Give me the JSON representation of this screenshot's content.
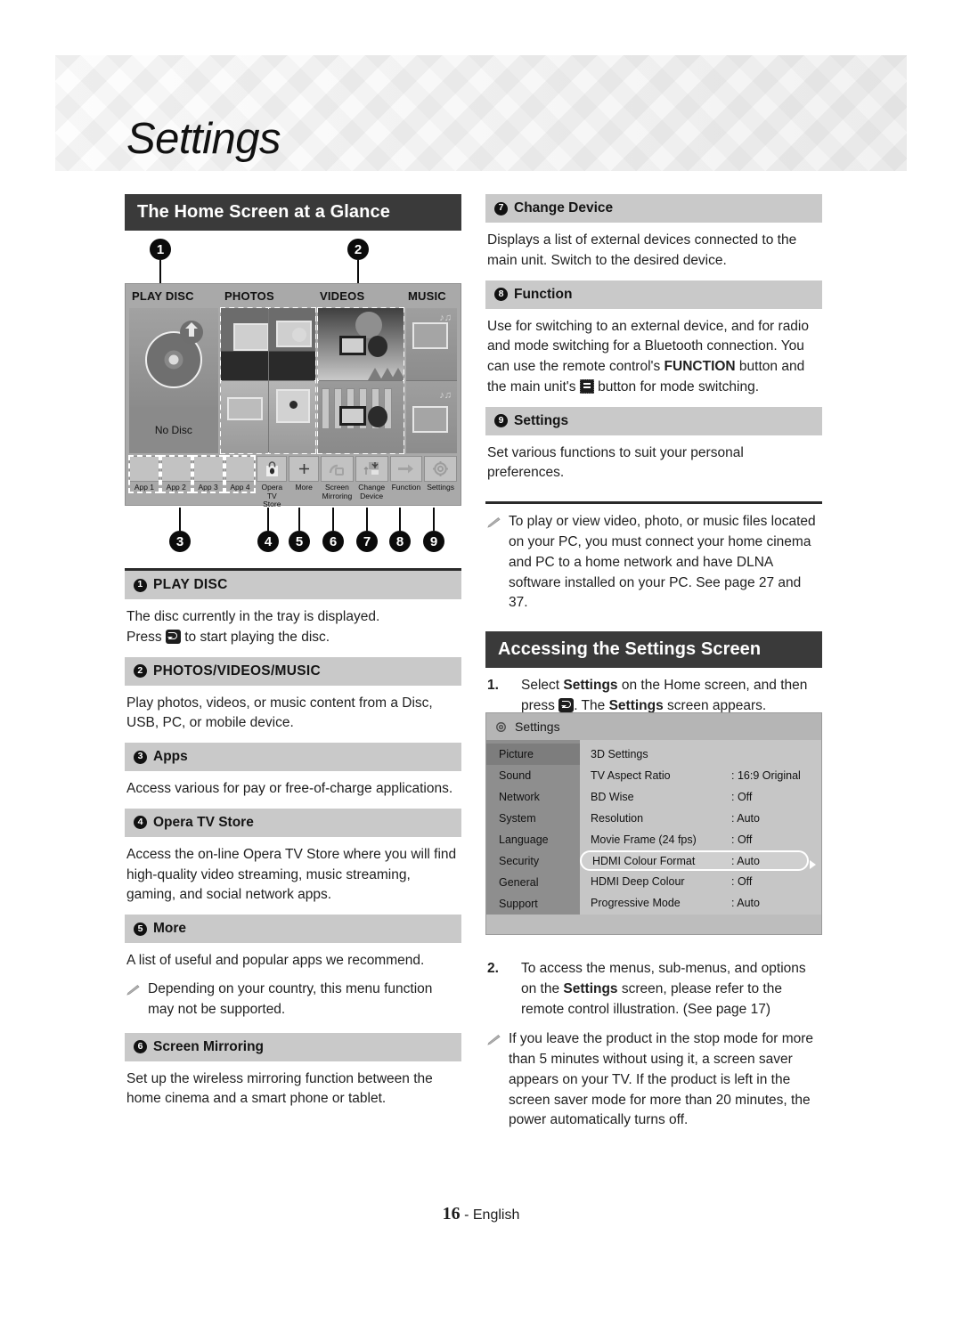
{
  "header": {
    "title": "Settings"
  },
  "left": {
    "section_title": "The Home Screen at a Glance",
    "callouts_top": [
      "1",
      "2"
    ],
    "callouts_bottom": [
      "3",
      "4",
      "5",
      "6",
      "7",
      "8",
      "9"
    ],
    "home_screen": {
      "categories": [
        "PLAY DISC",
        "PHOTOS",
        "VIDEOS",
        "MUSIC"
      ],
      "disc_status": "No Disc",
      "apps": [
        "App 1",
        "App 2",
        "App 3",
        "App 4"
      ],
      "bar_items": [
        {
          "label_line1": "Opera TV",
          "label_line2": "Store",
          "icon": "shopping-bag-icon"
        },
        {
          "label_line1": "More",
          "label_line2": "",
          "icon": "plus-icon"
        },
        {
          "label_line1": "Screen",
          "label_line2": "Mirroring",
          "icon": "screen-mirroring-icon"
        },
        {
          "label_line1": "Change",
          "label_line2": "Device",
          "icon": "change-device-icon"
        },
        {
          "label_line1": "Function",
          "label_line2": "",
          "icon": "arrow-right-icon"
        },
        {
          "label_line1": "Settings",
          "label_line2": "",
          "icon": "gear-icon"
        }
      ]
    },
    "entries": [
      {
        "num": "1",
        "title": "PLAY DISC",
        "caps": true,
        "body_a": "The disc currently in the tray is displayed.",
        "body_b_pre": "Press ",
        "body_b_post": " to start playing the disc."
      },
      {
        "num": "2",
        "title": "PHOTOS/VIDEOS/MUSIC",
        "caps": true,
        "body": "Play photos, videos, or music content from a Disc, USB, PC, or mobile device."
      },
      {
        "num": "3",
        "title": "Apps",
        "caps": false,
        "body": "Access various for pay or free-of-charge applications."
      },
      {
        "num": "4",
        "title": "Opera TV Store",
        "caps": false,
        "body": "Access the on-line Opera TV Store where you will find high-quality video streaming, music streaming, gaming, and social network apps."
      },
      {
        "num": "5",
        "title": "More",
        "caps": false,
        "body": "A list of useful and popular apps we recommend.",
        "note": "Depending on your country, this menu function may not be supported."
      },
      {
        "num": "6",
        "title": "Screen Mirroring",
        "caps": false,
        "body": "Set up the wireless mirroring function between the home cinema and a smart phone or tablet."
      }
    ]
  },
  "right": {
    "entries": [
      {
        "num": "7",
        "title": "Change Device",
        "body": "Displays a list of external devices connected to the main unit. Switch to the desired device."
      },
      {
        "num": "8",
        "title": "Function",
        "body_p1": "Use for switching to an external device, and for radio and mode switching for a Bluetooth connection. You can use the remote control's ",
        "body_bold": "FUNCTION",
        "body_p2": " button and the main unit's ",
        "body_p3": " button for mode switching."
      },
      {
        "num": "9",
        "title": "Settings",
        "body": "Set various functions to suit your personal preferences."
      }
    ],
    "note_dlna": "To play or view video, photo, or music files located on your PC, you must connect your home cinema and PC to a home network and have DLNA software installed on your PC. See page 27 and 37.",
    "section_title": "Accessing the Settings Screen",
    "step1": {
      "n": "1.",
      "pre": "Select ",
      "b1": "Settings",
      "mid": " on the Home screen, and then press ",
      "post_pre": ". The ",
      "b2": "Settings",
      "post": " screen appears."
    },
    "step2": {
      "n": "2.",
      "pre": "To access the menus, sub-menus, and options on the ",
      "b1": "Settings",
      "post": " screen, please refer to the remote control illustration. (See page 17)"
    },
    "note_saver": "If you leave the product in the stop mode for more than 5 minutes without using it, a screen saver appears on your TV. If the product is left in the screen saver mode for more than 20 minutes, the power automatically turns off.",
    "settings_screen": {
      "title": "Settings",
      "nav": [
        "Picture",
        "Sound",
        "Network",
        "System",
        "Language",
        "Security",
        "General",
        "Support"
      ],
      "active_nav": "Picture",
      "rows": [
        {
          "label": "3D Settings",
          "value": ""
        },
        {
          "label": "TV Aspect Ratio",
          "value": ": 16:9 Original"
        },
        {
          "label": "BD Wise",
          "value": ": Off"
        },
        {
          "label": "Resolution",
          "value": ": Auto"
        },
        {
          "label": "Movie Frame (24 fps)",
          "value": ": Off"
        },
        {
          "label": "HDMI Colour Format",
          "value": ": Auto",
          "selected": true
        },
        {
          "label": "HDMI Deep Colour",
          "value": ": Off"
        },
        {
          "label": "Progressive Mode",
          "value": ": Auto"
        }
      ]
    }
  },
  "footer": {
    "page": "16",
    "lang": "- English"
  }
}
